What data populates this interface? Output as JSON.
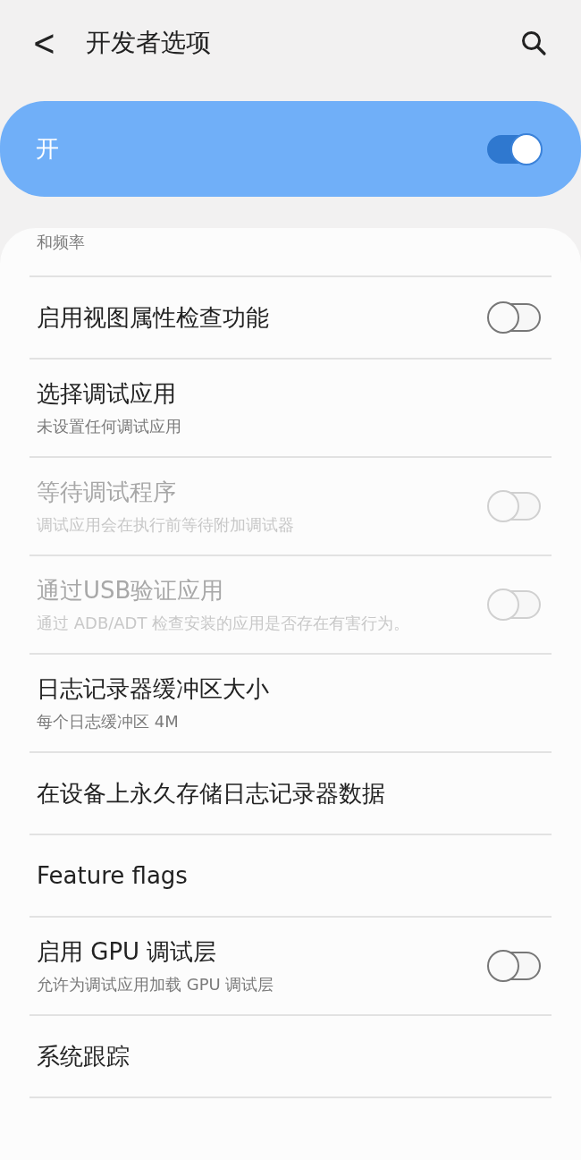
{
  "header": {
    "back": "<",
    "title": "开发者选项"
  },
  "master": {
    "label": "开",
    "on": true
  },
  "items": [
    {
      "kind": "plain",
      "summary": "和频率",
      "disabled": false
    },
    {
      "kind": "toggle",
      "title": "启用视图属性检查功能",
      "on": false,
      "disabled": false
    },
    {
      "kind": "plain",
      "title": "选择调试应用",
      "summary": "未设置任何调试应用",
      "disabled": false
    },
    {
      "kind": "toggle",
      "title": "等待调试程序",
      "summary": "调试应用会在执行前等待附加调试器",
      "on": false,
      "disabled": true
    },
    {
      "kind": "toggle",
      "title": "通过USB验证应用",
      "summary": "通过 ADB/ADT 检查安装的应用是否存在有害行为。",
      "on": false,
      "disabled": true
    },
    {
      "kind": "plain",
      "title": "日志记录器缓冲区大小",
      "summary": "每个日志缓冲区 4M",
      "disabled": false
    },
    {
      "kind": "plain",
      "title": "在设备上永久存储日志记录器数据",
      "disabled": false
    },
    {
      "kind": "plain",
      "title": "Feature flags",
      "disabled": false
    },
    {
      "kind": "toggle",
      "title": "启用 GPU 调试层",
      "summary": "允许为调试应用加载 GPU 调试层",
      "on": false,
      "disabled": false
    },
    {
      "kind": "plain",
      "title": "系统跟踪",
      "disabled": false
    }
  ]
}
